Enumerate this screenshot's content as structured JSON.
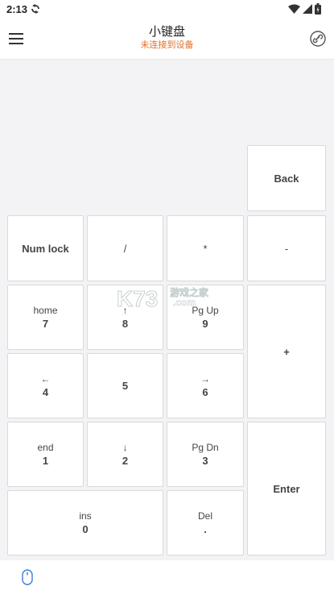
{
  "status_bar": {
    "time": "2:13",
    "icons": [
      "sync-icon",
      "wifi-icon",
      "signal-icon",
      "battery-icon"
    ]
  },
  "app_bar": {
    "title": "小键盘",
    "subtitle": "未连接到设备",
    "menu_icon": "hamburger-menu-icon",
    "link_icon": "link-device-icon"
  },
  "keypad": {
    "back": "Back",
    "numlock": "Num lock",
    "divide": "/",
    "multiply": "*",
    "minus": "-",
    "k7": {
      "top": "home",
      "bottom": "7"
    },
    "k8": {
      "top": "↑",
      "bottom": "8"
    },
    "k9": {
      "top": "Pg Up",
      "bottom": "9"
    },
    "plus": "+",
    "k4": {
      "top": "←",
      "bottom": "4"
    },
    "k5": "5",
    "k6": {
      "top": "→",
      "bottom": "6"
    },
    "k1": {
      "top": "end",
      "bottom": "1"
    },
    "k2": {
      "top": "↓",
      "bottom": "2"
    },
    "k3": {
      "top": "Pg Dn",
      "bottom": "3"
    },
    "enter": "Enter",
    "k0": {
      "top": "ins",
      "bottom": "0"
    },
    "kdot": {
      "top": "Del",
      "bottom": "."
    }
  },
  "watermark": {
    "text": "游戏之家",
    "sub": ".com",
    "logo": "K73"
  },
  "bottom_bar": {
    "mouse_icon": "mouse-icon"
  },
  "colors": {
    "subtitle": "#e0702a",
    "accent": "#3b7de0",
    "background": "#f3f3f5"
  }
}
